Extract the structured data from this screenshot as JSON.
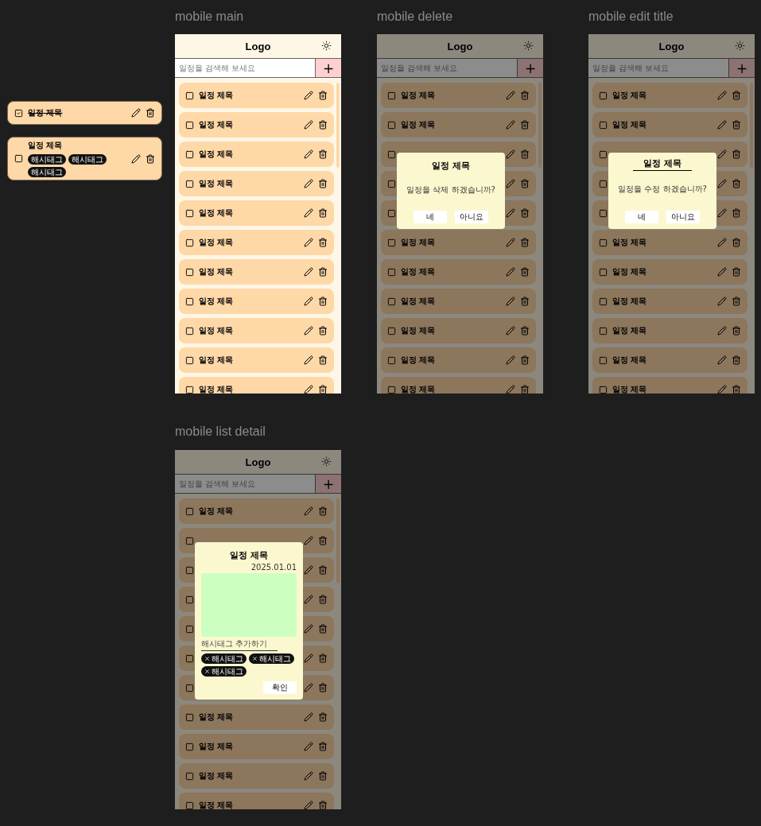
{
  "components": [
    {
      "title": "일정 제목",
      "checked": true
    },
    {
      "title": "일정 제목",
      "checked": false,
      "tags": [
        "해시태그",
        "해시태그",
        "해시태그"
      ]
    }
  ],
  "frames": [
    {
      "label": "mobile main",
      "kind": "main",
      "dimmed": false,
      "logo": "Logo",
      "search_placeholder": "일정을 검색해 보세요",
      "add": "+",
      "items": [
        {
          "title": "일정 제목",
          "checked": false
        },
        {
          "title": "일정 제목",
          "checked": false
        },
        {
          "title": "일정 제목",
          "checked": false
        },
        {
          "title": "일정 제목",
          "checked": false
        },
        {
          "title": "일정 제목",
          "checked": false
        },
        {
          "title": "일정 제목",
          "checked": false
        },
        {
          "title": "일정 제목",
          "checked": false
        },
        {
          "title": "일정 제목",
          "checked": false
        },
        {
          "title": "일정 제목",
          "checked": false
        },
        {
          "title": "일정 제목",
          "checked": false
        },
        {
          "title": "일정 제목",
          "checked": false
        }
      ]
    },
    {
      "label": "mobile delete",
      "kind": "delete",
      "dimmed": true,
      "logo": "Logo",
      "search_placeholder": "일정을 검색해 보세요",
      "add": "+",
      "items": [
        {
          "title": "일정 제목",
          "checked": false
        },
        {
          "title": "일정 제목",
          "checked": false
        },
        {
          "checked": false
        },
        {
          "checked": false
        },
        {
          "checked": false
        },
        {
          "title": "일정 제목",
          "checked": false
        },
        {
          "title": "일정 제목",
          "checked": false
        },
        {
          "title": "일정 제목",
          "checked": false
        },
        {
          "title": "일정 제목",
          "checked": false
        },
        {
          "title": "일정 제목",
          "checked": false
        },
        {
          "title": "일정 제목",
          "checked": false
        }
      ],
      "modal": {
        "title": "일정 제목",
        "message": "일정을 삭제 하겠습니까?",
        "yes": "네",
        "no": "아니요"
      }
    },
    {
      "label": "mobile edit title",
      "kind": "edit",
      "dimmed": true,
      "logo": "Logo",
      "search_placeholder": "일정을 검색해 보세요",
      "add": "+",
      "items": [
        {
          "title": "일정 제목",
          "checked": false
        },
        {
          "title": "일정 제목",
          "checked": false
        },
        {
          "checked": false
        },
        {
          "checked": false
        },
        {
          "checked": false
        },
        {
          "title": "일정 제목",
          "checked": false
        },
        {
          "title": "일정 제목",
          "checked": false
        },
        {
          "title": "일정 제목",
          "checked": false
        },
        {
          "title": "일정 제목",
          "checked": false
        },
        {
          "title": "일정 제목",
          "checked": false
        },
        {
          "title": "일정 제목",
          "checked": false
        }
      ],
      "modal": {
        "title": "일정 제목",
        "message": "일정을 수정 하겠습니까?",
        "yes": "네",
        "no": "아니요"
      }
    },
    {
      "label": "mobile list detail",
      "kind": "detail",
      "dimmed": true,
      "logo": "Logo",
      "search_placeholder": "일정을 검색해 보세요",
      "add": "+",
      "items": [
        {
          "title": "일정 제목",
          "checked": false
        },
        {
          "checked": false
        },
        {
          "checked": false
        },
        {
          "checked": false
        },
        {
          "checked": false
        },
        {
          "checked": false
        },
        {
          "checked": false
        },
        {
          "title": "일정 제목",
          "checked": false
        },
        {
          "title": "일정 제목",
          "checked": false
        },
        {
          "title": "일정 제목",
          "checked": false
        },
        {
          "title": "일정 제목",
          "checked": false
        }
      ],
      "modal": {
        "title": "일정 제목",
        "date": "2025.01.01",
        "hashtag_placeholder": "해시태그 추가하기",
        "tags": [
          "해시태그",
          "해시태그",
          "해시태그"
        ],
        "confirm": "확인"
      }
    }
  ]
}
